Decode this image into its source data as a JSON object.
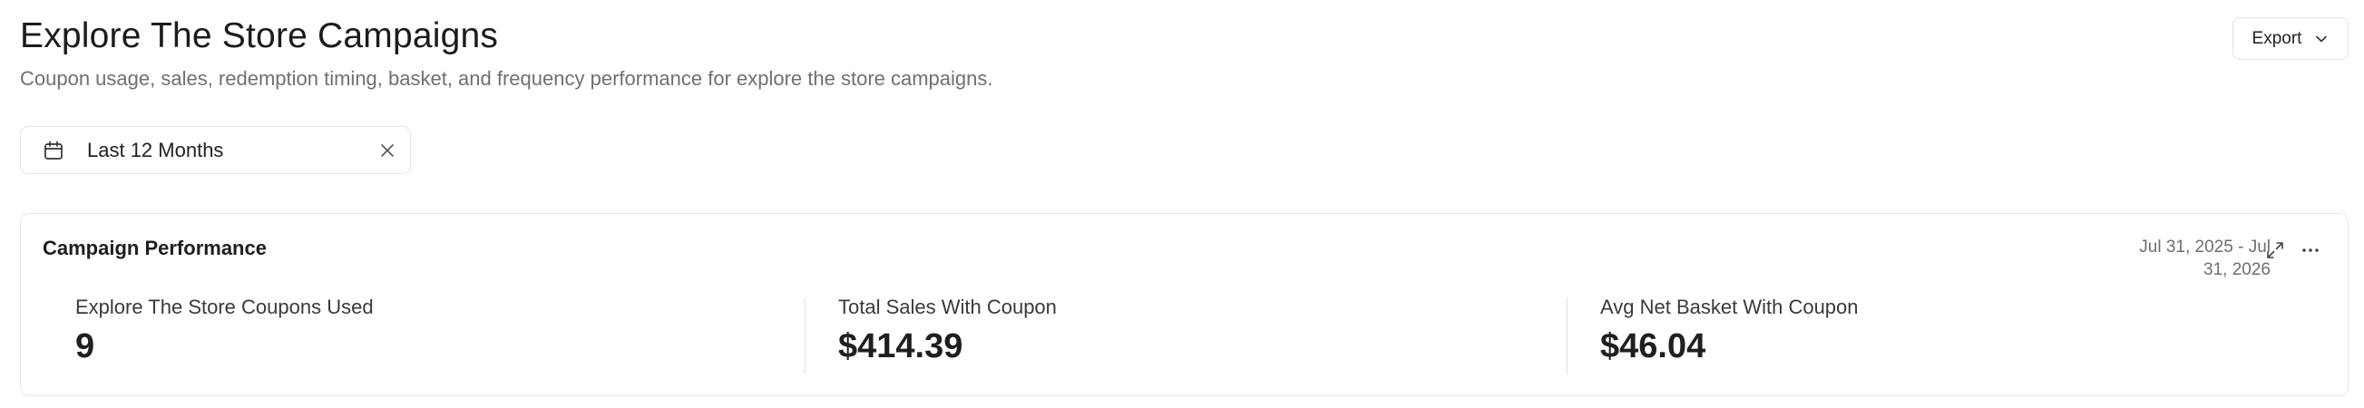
{
  "header": {
    "title": "Explore The Store Campaigns",
    "subtitle": "Coupon usage, sales, redemption timing, basket, and frequency performance for explore the store campaigns.",
    "export_label": "Export",
    "export_icon": "chevron-down-icon"
  },
  "filter": {
    "icon": "calendar-icon",
    "label": "Last 12 Months",
    "clear_icon": "close-icon"
  },
  "card": {
    "title": "Campaign Performance",
    "date_range_line1": "Jul 31, 2025 - Jul",
    "date_range_line2": "31, 2026",
    "expand_icon": "expand-icon",
    "more_icon": "more-horizontal-icon",
    "metrics": [
      {
        "label": "Explore The Store Coupons Used",
        "value": "9"
      },
      {
        "label": "Total Sales With Coupon",
        "value": "$414.39"
      },
      {
        "label": "Avg Net Basket With Coupon",
        "value": "$46.04"
      }
    ]
  }
}
